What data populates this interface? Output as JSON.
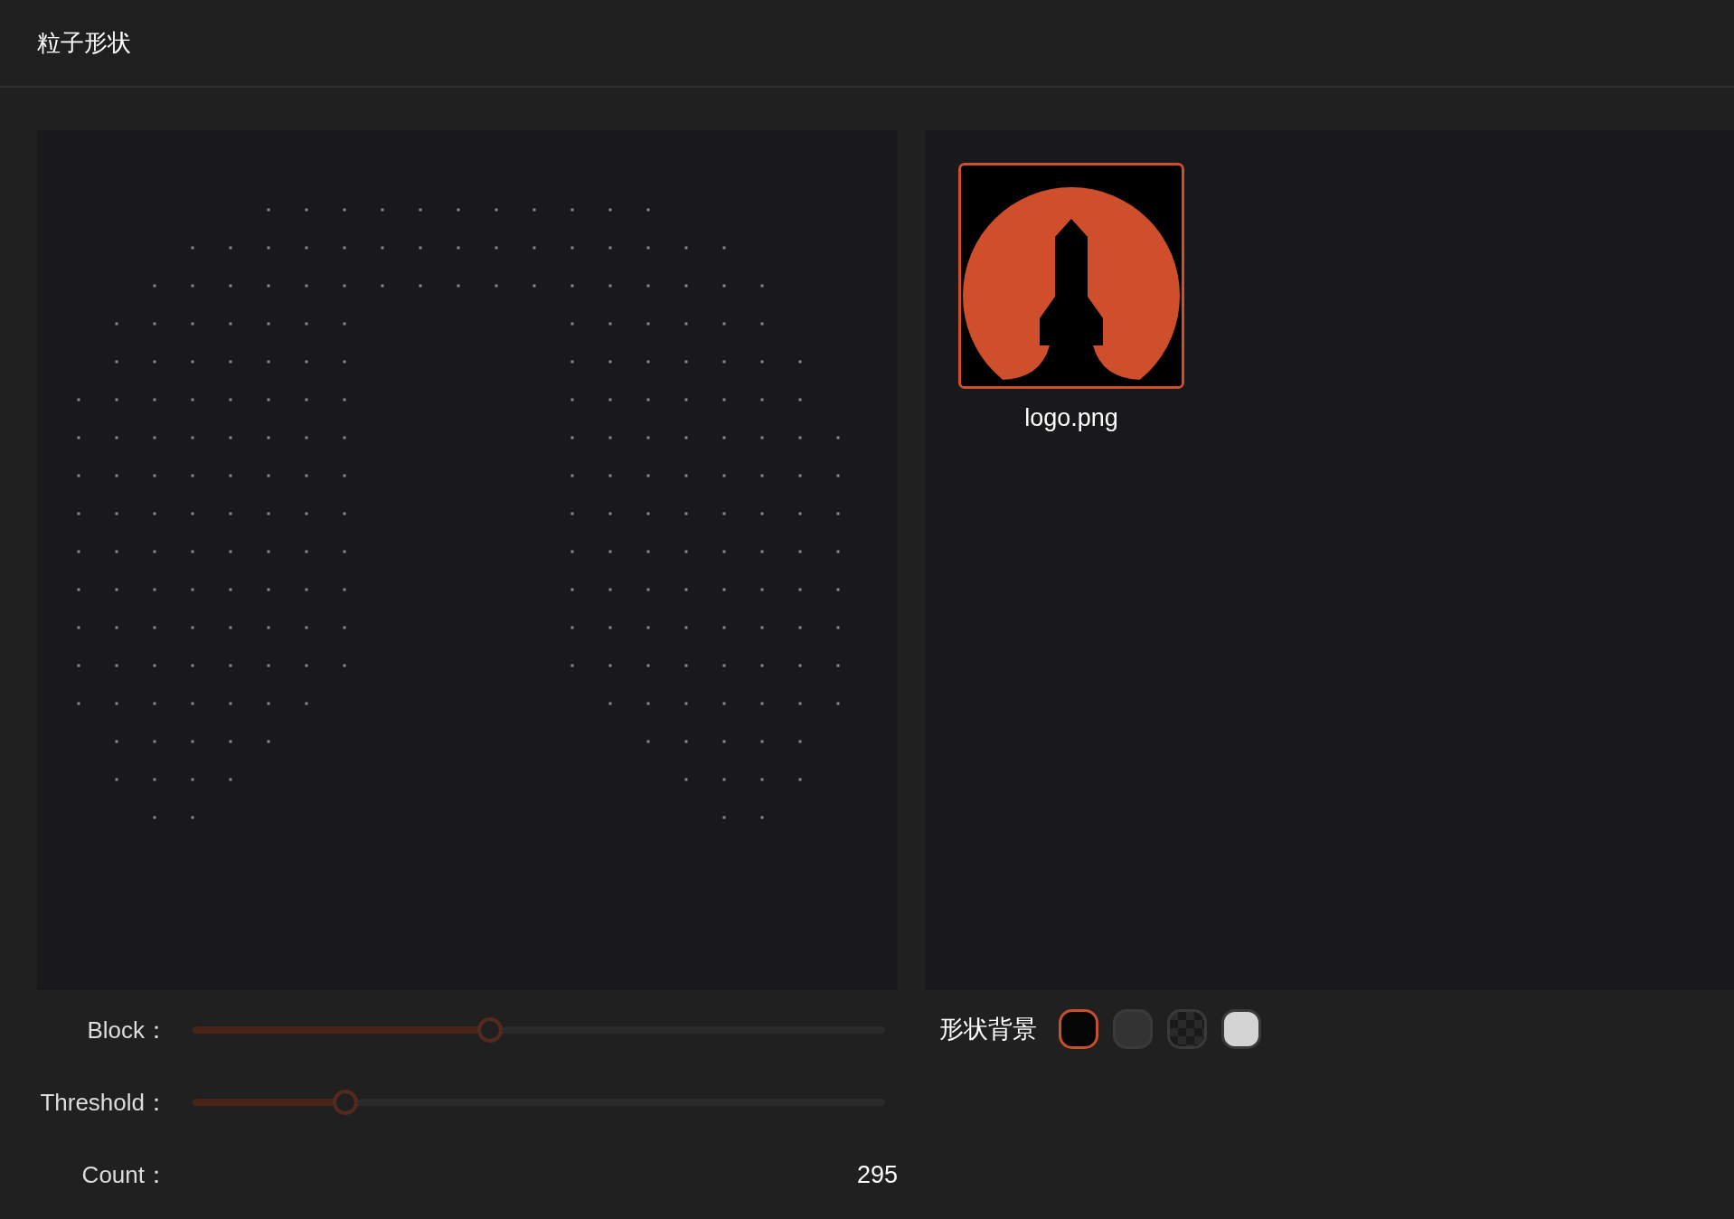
{
  "header": {
    "title": "粒子形状"
  },
  "images": [
    {
      "name": "logo.png",
      "selected": true
    }
  ],
  "sliders": [
    {
      "label": "Block：",
      "level": 0.43
    },
    {
      "label": "Threshold：",
      "level": 0.22
    }
  ],
  "count": {
    "label": "Count：",
    "value": "295"
  },
  "background": {
    "label": "形状背景",
    "swatches": [
      {
        "kind": "solid",
        "color": "#050505",
        "selected": true
      },
      {
        "kind": "solid",
        "color": "#333333",
        "selected": false
      },
      {
        "kind": "checker",
        "color": "#2a2a2a",
        "selected": false
      },
      {
        "kind": "solid",
        "color": "#d4d4d4",
        "selected": false
      }
    ]
  }
}
